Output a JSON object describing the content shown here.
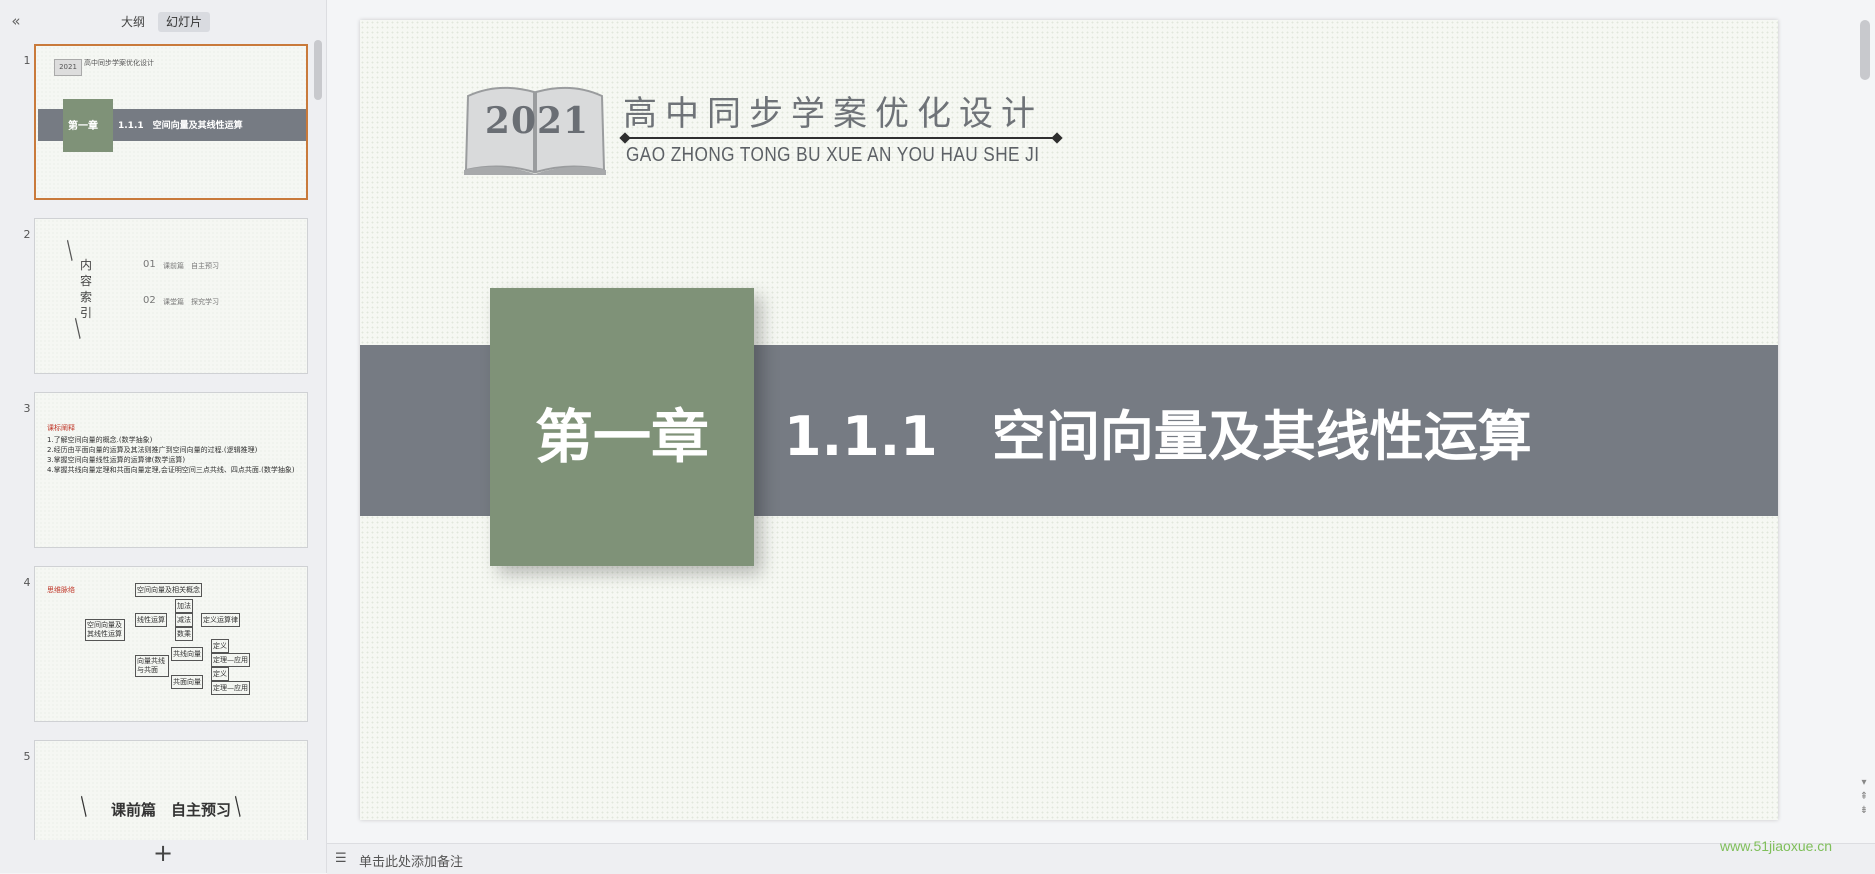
{
  "sidebar": {
    "collapse_icon": "«",
    "tabs": [
      {
        "label": "大纲"
      },
      {
        "label": "幻灯片"
      }
    ],
    "add_icon": "+",
    "thumbnails": [
      {
        "num": "1",
        "year": "2021",
        "head": "高中同步学案优化设计",
        "chapter": "第一章",
        "title": "1.1.1　空间向量及其线性运算"
      },
      {
        "num": "2",
        "vertical": "内容索引",
        "items": [
          {
            "n": "01",
            "text": "课前篇　自主预习"
          },
          {
            "n": "02",
            "text": "课堂篇　探究学习"
          }
        ]
      },
      {
        "num": "3",
        "heading": "课标阐释",
        "lines": [
          "1.了解空间向量的概念.(数学抽象)",
          "2.经历由平面向量的运算及其法则推广到空间向量的过程.(逻辑推理)",
          "3.掌握空间向量线性运算的运算律(数学运算)",
          "4.掌握共线向量定理和共面向量定理,会证明空间三点共线、四点共面.(数学抽象)"
        ]
      },
      {
        "num": "4",
        "heading": "思维脉络",
        "root": "空间向量及其线性运算",
        "b1": "空间向量及相关概念",
        "b2": "线性运算",
        "b2a": "加法",
        "b2b": "减法",
        "b2c": "数乘",
        "b2d": "定义运算律",
        "b3": "向量共线与共面",
        "b3a": "共线向量",
        "b3b": "共面向量",
        "d1": "定义",
        "d2": "定理—应用",
        "d3": "定义",
        "d4": "定理—应用"
      },
      {
        "num": "5",
        "title": "课前篇　自主预习"
      }
    ]
  },
  "slide": {
    "year": "2021",
    "header_cn": "高中同步学案优化设计",
    "header_pinyin": "GAO ZHONG TONG BU XUE AN YOU HAU SHE JI",
    "chapter": "第一章",
    "title": "1.1.1　空间向量及其线性运算",
    "banner_color": "#767b83",
    "green_color": "#7f9278"
  },
  "notes": {
    "icon": "notes-icon",
    "placeholder": "单击此处添加备注"
  },
  "watermark": "www.51jiaoxue.cn"
}
